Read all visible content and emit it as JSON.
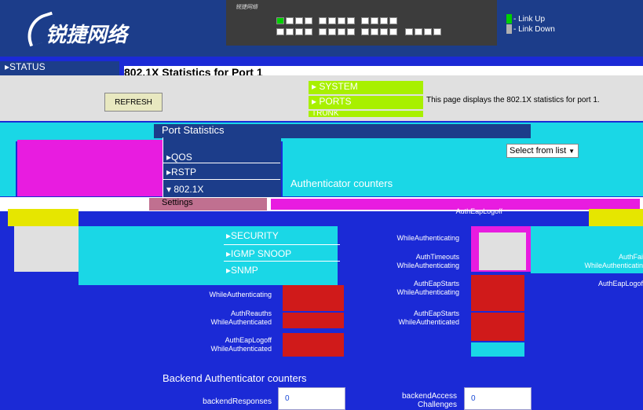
{
  "brand": {
    "name": "锐捷网络",
    "switch_label": "锐捷网络"
  },
  "legend": {
    "link_up": "- Link Up",
    "link_down": "- Link Down",
    "up_color": "#00d000",
    "down_color": "#b0b0b0"
  },
  "nav": {
    "status": "STATUS",
    "system": "SYSTEM",
    "ports": "PORTS",
    "trunk": "TRUNK",
    "qos": "QOS",
    "rstp": "RSTP",
    "dot1x": "802.1X",
    "settings": "Settings",
    "security": "SECURITY",
    "igmp_snoop": "IGMP SNOOP",
    "snmp": "SNMP"
  },
  "page": {
    "title": "802.1X Statistics for Port 1",
    "refresh_label": "REFRESH",
    "description": "This page displays the 802.1X statistics for port 1."
  },
  "port_statistics": {
    "heading": "Port Statistics",
    "select_value": "Select from list"
  },
  "authenticator": {
    "heading": "Authenticator counters",
    "col_mid": "AuthEapLogoff",
    "labels_left": [
      "AuthFailWhile",
      "AuthReauths\nWhileAuthenticated",
      "AuthEapLogoff\nWhileAuthenticated"
    ],
    "labels_mid": [
      "AuthTimeouts\nWhileAuthenticating",
      "AuthEapStarts\nWhileAuthenticating",
      "AuthEapStarts\nWhileAuthenticated"
    ],
    "labels_right": [
      "AuthFai\nWhileAuthenticatin",
      "AuthEapLogof"
    ],
    "wa_label": "WhileAuthenticating"
  },
  "backend": {
    "heading": "Backend Authenticator counters",
    "fields": [
      {
        "label": "backendResponses",
        "value": "0"
      },
      {
        "label": "backendAccess\nChallenges",
        "value": "0"
      }
    ]
  }
}
